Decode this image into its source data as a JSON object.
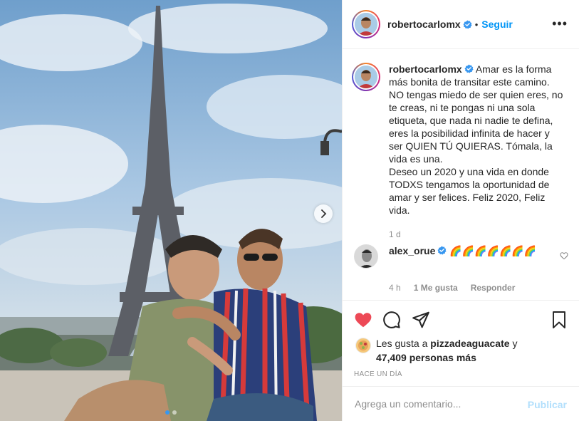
{
  "header": {
    "username": "robertocarlomx",
    "separator": "•",
    "follow_label": "Seguir",
    "more_label": "•••"
  },
  "caption": {
    "username": "robertocarlomx",
    "text": "Amar es la forma más bonita de transitar este camino. NO tengas miedo de ser quien eres, no te creas, ni te pongas ni una sola etiqueta, que nada ni nadie te defina, eres la posibilidad infinita de hacer y ser QUIEN TÚ QUIERAS. Tómala, la vida es una.\nDeseo un 2020 y una vida en donde TODXS tengamos la oportunidad de amar y ser felices. Feliz 2020, Feliz vida.",
    "time": "1 d"
  },
  "comment": {
    "username": "alex_orue",
    "text": "🌈🌈🌈🌈🌈🌈🌈",
    "time": "4 h",
    "likes": "1 Me gusta",
    "reply_label": "Responder"
  },
  "likes": {
    "prefix": "Les gusta a",
    "first_user": "pizzadeaguacate",
    "connector": "y",
    "others": "47,409 personas más"
  },
  "date": "HACE UN DÍA",
  "add_comment": {
    "placeholder": "Agrega un comentario...",
    "publish_label": "Publicar"
  },
  "carousel": {
    "current": 1,
    "total": 2
  },
  "colors": {
    "accent": "#0095f6",
    "liked_heart": "#ed4956",
    "verified": "#3897f0",
    "publish_disabled": "#b2dffc"
  },
  "icons": [
    "verified-badge-icon",
    "heart-icon",
    "comment-icon",
    "share-icon",
    "bookmark-icon",
    "chevron-right-icon",
    "more-options-icon"
  ]
}
